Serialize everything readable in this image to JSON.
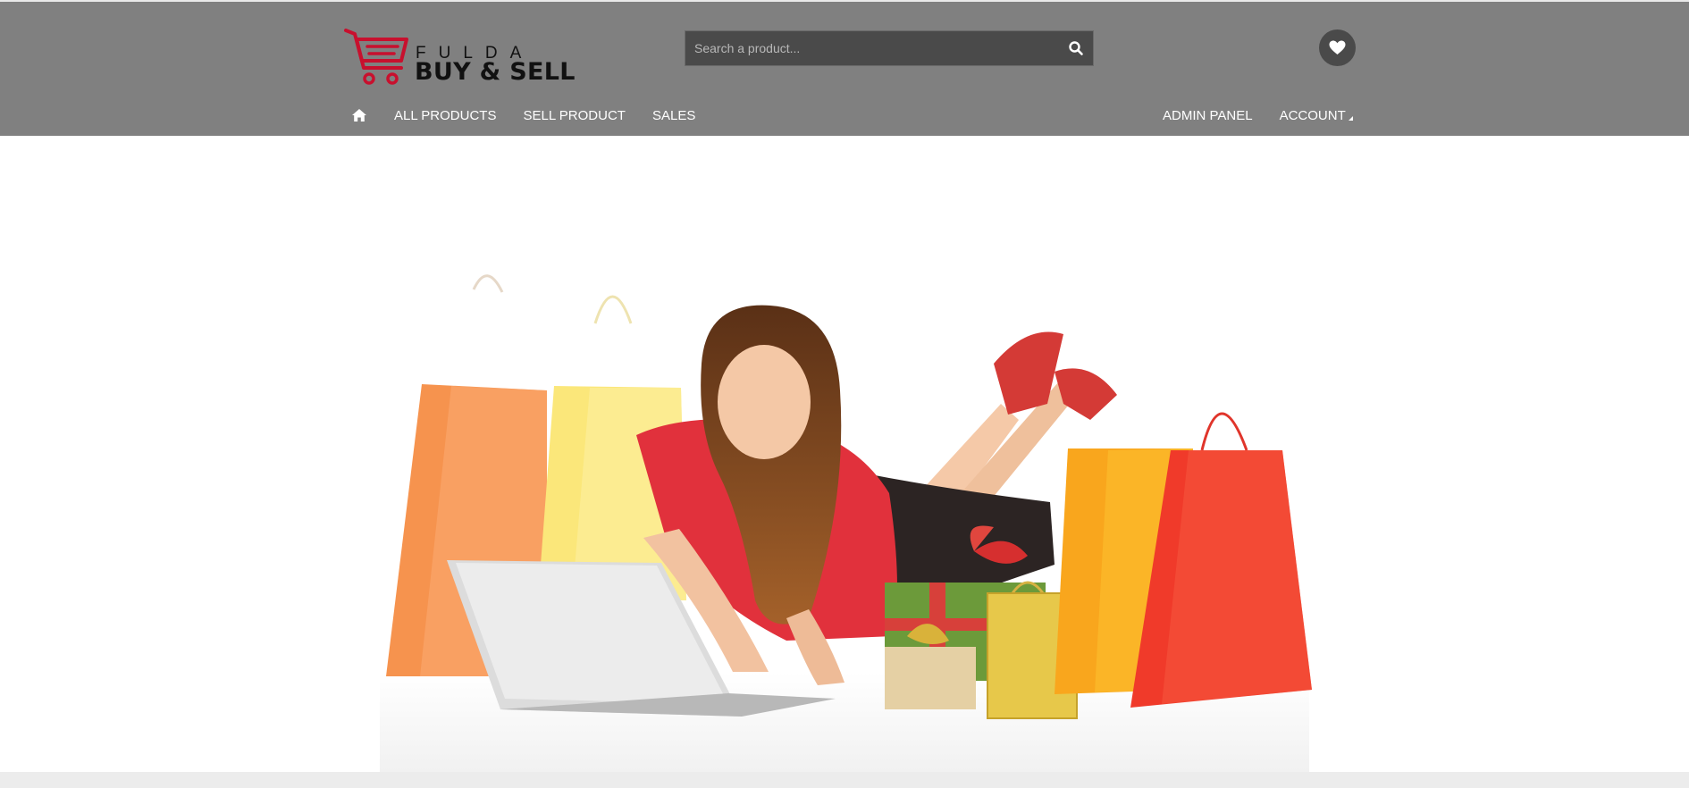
{
  "brand": {
    "line1": "FULDA",
    "line2": "BUY & SELL",
    "accent": "#c8102e"
  },
  "search": {
    "placeholder": "Search a product..."
  },
  "nav_left": [
    {
      "label": "ALL PRODUCTS"
    },
    {
      "label": "SELL PRODUCT"
    },
    {
      "label": "SALES"
    }
  ],
  "nav_right": [
    {
      "label": "ADMIN PANEL"
    },
    {
      "label": "ACCOUNT"
    }
  ],
  "icons": {
    "home": "home-icon",
    "search": "search-icon",
    "wishlist": "heart-icon",
    "account_dropdown": "caret-icon"
  },
  "colors": {
    "header_bg": "#808080",
    "search_bg": "#4a4a4a",
    "nav_text": "#ffffff"
  }
}
